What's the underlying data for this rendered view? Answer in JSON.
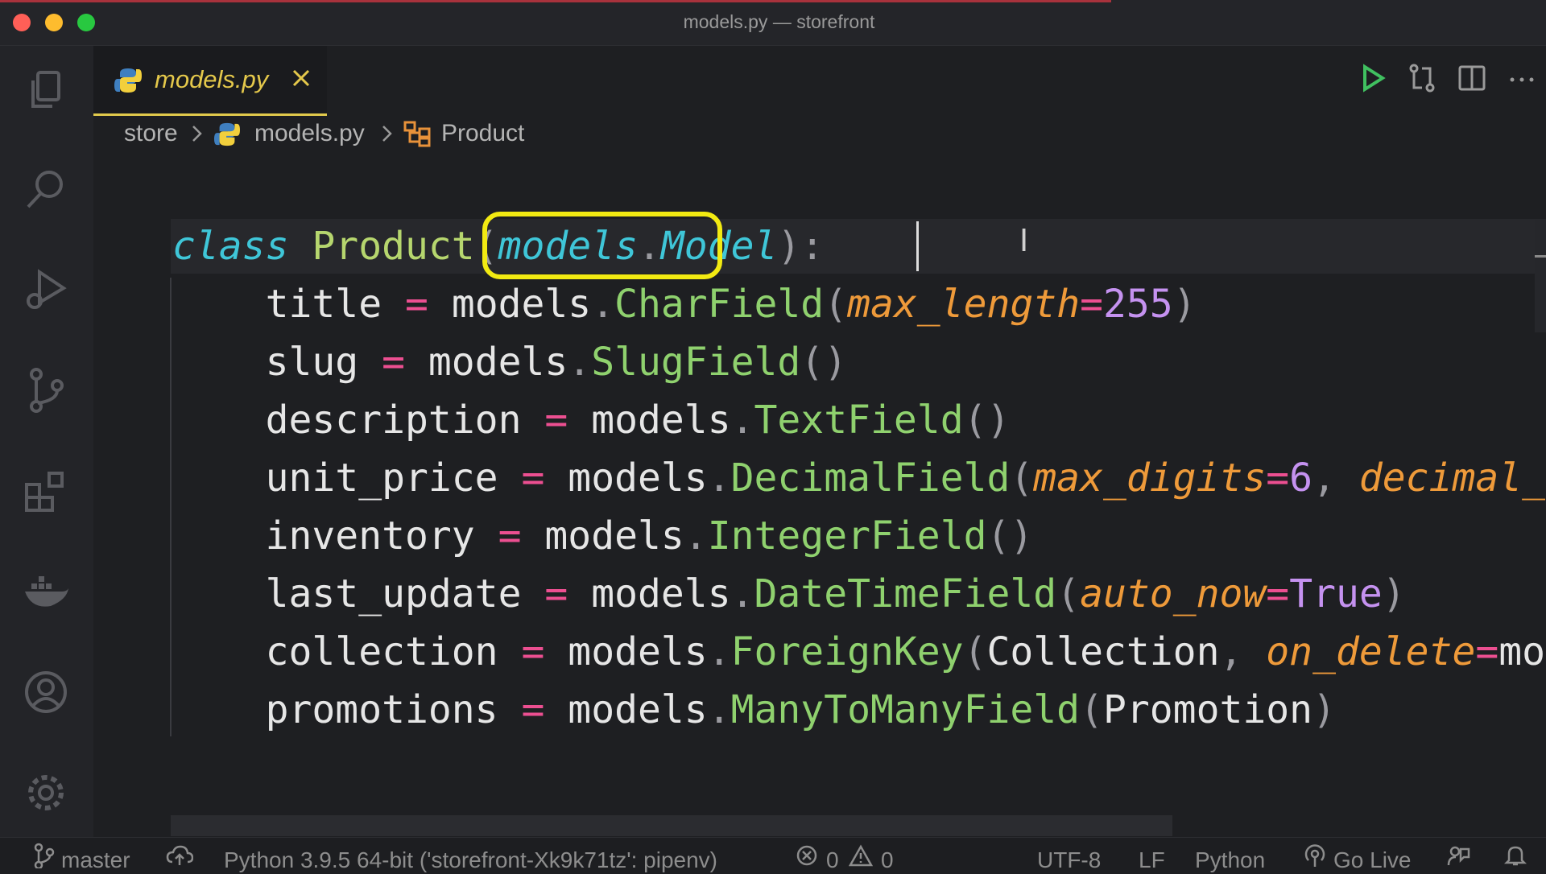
{
  "window": {
    "title": "models.py — storefront"
  },
  "activity_bar": {
    "items": [
      "explorer-icon",
      "search-icon",
      "run-debug-icon",
      "source-control-icon",
      "extensions-icon",
      "docker-icon",
      "account-icon",
      "settings-gear-icon"
    ]
  },
  "tab": {
    "label": "models.py",
    "close_symbol": "✕"
  },
  "tab_actions": [
    "run-icon",
    "compare-icon",
    "split-editor-icon",
    "more-actions-icon"
  ],
  "breadcrumbs": {
    "folder": "store",
    "file": "models.py",
    "symbol": "Product",
    "separator": "›"
  },
  "code": {
    "l0": {
      "kw": "class",
      "name": "Product",
      "paren_open": "(",
      "mod": "models",
      "dot": ".",
      "base": "Model",
      "paren_close": ")",
      "colon": ":"
    },
    "lines": [
      {
        "var": "title",
        "eq": "=",
        "mod": "models",
        "dot": ".",
        "fn": "CharField",
        "open": "(",
        "p1": "max_length",
        "eq1": "=",
        "v1": "255",
        "close": ")"
      },
      {
        "var": "slug",
        "eq": "=",
        "mod": "models",
        "dot": ".",
        "fn": "SlugField",
        "parens": "()"
      },
      {
        "var": "description",
        "eq": "=",
        "mod": "models",
        "dot": ".",
        "fn": "TextField",
        "parens": "()"
      },
      {
        "var": "unit_price",
        "eq": "=",
        "mod": "models",
        "dot": ".",
        "fn": "DecimalField",
        "open": "(",
        "p1": "max_digits",
        "eq1": "=",
        "v1": "6",
        "comma": ", ",
        "p2": "decimal_"
      },
      {
        "var": "inventory",
        "eq": "=",
        "mod": "models",
        "dot": ".",
        "fn": "IntegerField",
        "parens": "()"
      },
      {
        "var": "last_update",
        "eq": "=",
        "mod": "models",
        "dot": ".",
        "fn": "DateTimeField",
        "open": "(",
        "p1": "auto_now",
        "eq1": "=",
        "v1": "True",
        "close": ")"
      },
      {
        "var": "collection",
        "eq": "=",
        "mod": "models",
        "dot": ".",
        "fn": "ForeignKey",
        "open": "(",
        "a1": "Collection",
        "comma": ", ",
        "p2": "on_delete",
        "eq2": "=",
        "tail": "mo"
      },
      {
        "var": "promotions",
        "eq": "=",
        "mod": "models",
        "dot": ".",
        "fn": "ManyToManyField",
        "open": "(",
        "a1": "Promotion",
        "close": ")"
      }
    ]
  },
  "status_bar": {
    "branch": "master",
    "interpreter": "Python 3.9.5 64-bit ('storefront-Xk9k71tz': pipenv)",
    "errors": "0",
    "warnings": "0",
    "encoding": "UTF-8",
    "eol": "LF",
    "language": "Python",
    "go_live": "Go Live"
  },
  "colors": {
    "accent_tab": "#e0c94c",
    "highlight_box": "#f2ea12",
    "keyword": "#3fc6d8",
    "class_name": "#b6d66e"
  }
}
